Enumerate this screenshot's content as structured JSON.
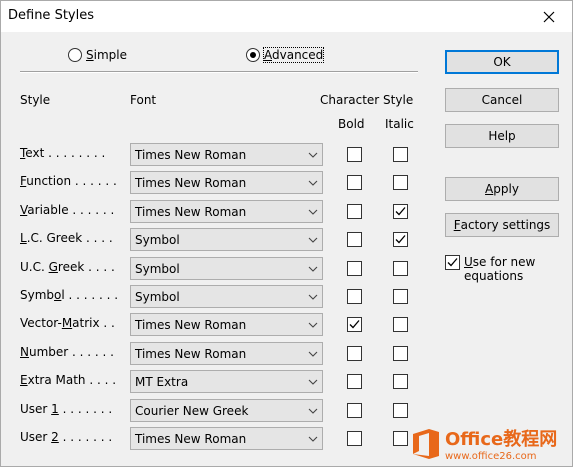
{
  "window": {
    "title": "Define Styles"
  },
  "mode": {
    "simple_prefix": "",
    "simple_accel": "S",
    "simple_rest": "imple",
    "advanced_prefix": "",
    "advanced_accel": "A",
    "advanced_rest": "dvanced",
    "selected": "Advanced"
  },
  "headers": {
    "style": "Style",
    "font": "Font",
    "character_style": "Character Style",
    "bold": "Bold",
    "italic": "Italic"
  },
  "rows": [
    {
      "pre": "",
      "accel": "T",
      "post": "ext . . . . . . . .",
      "font": "Times New Roman",
      "bold": false,
      "italic": false
    },
    {
      "pre": "",
      "accel": "F",
      "post": "unction . . . . . .",
      "font": "Times New Roman",
      "bold": false,
      "italic": false
    },
    {
      "pre": "",
      "accel": "V",
      "post": "ariable . . . . . .",
      "font": "Times New Roman",
      "bold": false,
      "italic": true
    },
    {
      "pre": "",
      "accel": "L",
      "post": ".C. Greek . . . .",
      "font": "Symbol",
      "bold": false,
      "italic": true
    },
    {
      "pre": "U.C. ",
      "accel": "G",
      "post": "reek . . . .",
      "font": "Symbol",
      "bold": false,
      "italic": false
    },
    {
      "pre": "Symb",
      "accel": "o",
      "post": "l . . . . . . .",
      "font": "Symbol",
      "bold": false,
      "italic": false
    },
    {
      "pre": "Vector-",
      "accel": "M",
      "post": "atrix . .",
      "font": "Times New Roman",
      "bold": true,
      "italic": false
    },
    {
      "pre": "",
      "accel": "N",
      "post": "umber . . . . . .",
      "font": "Times New Roman",
      "bold": false,
      "italic": false
    },
    {
      "pre": "",
      "accel": "E",
      "post": "xtra Math . . . .",
      "font": "MT Extra",
      "bold": false,
      "italic": false
    },
    {
      "pre": "User ",
      "accel": "1",
      "post": " . . . . . . .",
      "font": "Courier New Greek",
      "bold": false,
      "italic": false
    },
    {
      "pre": "User ",
      "accel": "2",
      "post": " . . . . . . .",
      "font": "Times New Roman",
      "bold": false,
      "italic": false
    }
  ],
  "buttons": {
    "ok": "OK",
    "cancel": "Cancel",
    "help": "Help",
    "apply_accel": "A",
    "apply_rest": "pply",
    "factory_accel": "F",
    "factory_rest": "actory settings"
  },
  "use_for_new": {
    "accel": "U",
    "line1_rest": "se for new",
    "line2": "equations",
    "checked": true
  },
  "watermark": {
    "title": "Office教程网",
    "sub": "www.office26.com"
  },
  "colors": {
    "accent": "#0078d7",
    "watermark": "#e8681a"
  }
}
